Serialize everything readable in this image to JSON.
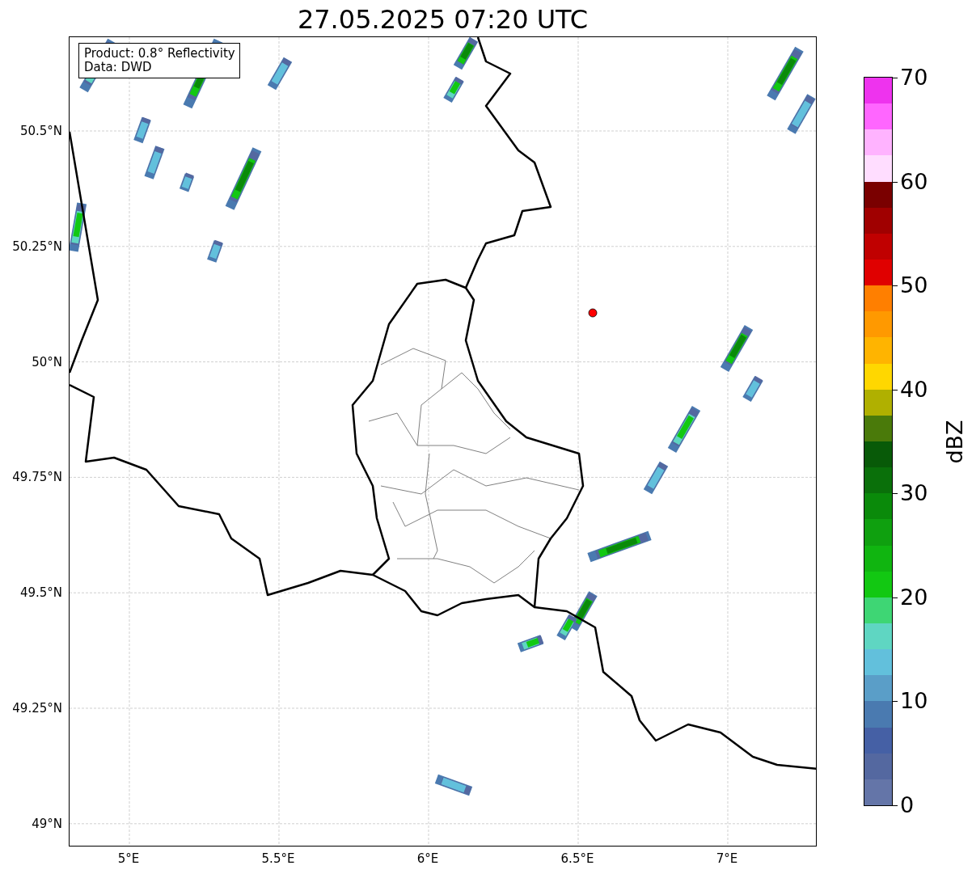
{
  "title": "27.05.2025 07:20 UTC",
  "map": {
    "info_box": [
      "Product: 0.8° Reflectivity",
      "Data: DWD"
    ],
    "lat_labels": [
      "50.5°N",
      "50.25°N",
      "50°N",
      "49.75°N",
      "49.5°N",
      "49.25°N",
      "49°N"
    ],
    "lon_labels": [
      "5°E",
      "5.5°E",
      "6°E",
      "6.5°E",
      "7°E"
    ]
  },
  "colorbar": {
    "label": "dBZ",
    "ticks": [
      "70",
      "60",
      "50",
      "40",
      "30",
      "20",
      "10",
      "0"
    ],
    "bands": [
      {
        "color": "#6475a8"
      },
      {
        "color": "#5468a0"
      },
      {
        "color": "#4560a5"
      },
      {
        "color": "#4a7ab0"
      },
      {
        "color": "#5a9ec8"
      },
      {
        "color": "#62c0dc"
      },
      {
        "color": "#5fd6c2"
      },
      {
        "color": "#3ed674"
      },
      {
        "color": "#12c812"
      },
      {
        "color": "#10b510"
      },
      {
        "color": "#0fa00f"
      },
      {
        "color": "#0a8a0a"
      },
      {
        "color": "#0a700a"
      },
      {
        "color": "#085a08"
      },
      {
        "color": "#4a7a0a"
      },
      {
        "color": "#b0b000"
      },
      {
        "color": "#ffd700"
      },
      {
        "color": "#ffb400"
      },
      {
        "color": "#ff9900"
      },
      {
        "color": "#ff7f00"
      },
      {
        "color": "#e00000"
      },
      {
        "color": "#c00000"
      },
      {
        "color": "#a00000"
      },
      {
        "color": "#7a0000"
      },
      {
        "color": "#ffddff"
      },
      {
        "color": "#ffb3ff"
      },
      {
        "color": "#ff66ff"
      },
      {
        "color": "#ee33ee"
      }
    ]
  }
}
